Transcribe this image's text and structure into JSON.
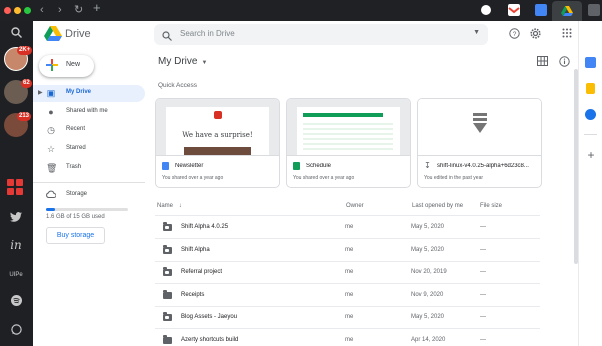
{
  "browser": {
    "tab_icons": [
      "github-icon",
      "gmail-icon",
      "calendar-icon",
      "drive-icon",
      "extensions-icon"
    ]
  },
  "rail": {
    "badges": [
      "2K+",
      "62",
      "213"
    ],
    "apps": [
      "twitter-icon",
      "inoreader-icon",
      "uipe-label",
      "spotify-icon",
      "whatsapp-icon"
    ],
    "uipe_label": "UIPe"
  },
  "header": {
    "brand": "Drive",
    "search_placeholder": "Search in Drive"
  },
  "sidebar": {
    "new_label": "New",
    "items": [
      {
        "label": "My Drive",
        "icon": "my-drive-icon"
      },
      {
        "label": "Shared with me",
        "icon": "shared-icon"
      },
      {
        "label": "Recent",
        "icon": "clock-icon"
      },
      {
        "label": "Starred",
        "icon": "star-icon"
      },
      {
        "label": "Trash",
        "icon": "trash-icon"
      }
    ],
    "storage_label": "Storage",
    "storage_text": "1.6 GB of 15 GB used",
    "storage_fraction": 0.107,
    "buy_label": "Buy storage"
  },
  "main": {
    "title": "My Drive",
    "quick_access_label": "Quick Access",
    "cards": [
      {
        "name": "Newsletter",
        "sub": "You shared over a year ago",
        "thumb_text": "We have a surprise!",
        "type_color": "#4285f4"
      },
      {
        "name": "Schedule",
        "sub": "You shared over a year ago",
        "type_color": "#0f9d58"
      },
      {
        "name": "shift-linux-v4.0.25-alpha+6d23c8...",
        "sub": "You edited in the past year",
        "type_color": "#5f6368"
      }
    ],
    "columns": {
      "name": "Name",
      "owner": "Owner",
      "last_opened": "Last opened by me",
      "size": "File size"
    },
    "rows": [
      {
        "name": "Shift Alpha 4.0.25",
        "owner": "me",
        "date": "May 5, 2020",
        "size": "—",
        "shared": true
      },
      {
        "name": "Shift Alpha",
        "owner": "me",
        "date": "May 5, 2020",
        "size": "—",
        "shared": true
      },
      {
        "name": "Referral project",
        "owner": "me",
        "date": "Nov 20, 2019",
        "size": "—",
        "shared": true
      },
      {
        "name": "Receipts",
        "owner": "me",
        "date": "Nov 9, 2020",
        "size": "—",
        "shared": false
      },
      {
        "name": "Blog Assets - Jaeyou",
        "owner": "me",
        "date": "May 5, 2020",
        "size": "—",
        "shared": true
      },
      {
        "name": "Azerty shortcuts build",
        "owner": "me",
        "date": "Apr 14, 2020",
        "size": "—",
        "shared": false
      }
    ]
  }
}
